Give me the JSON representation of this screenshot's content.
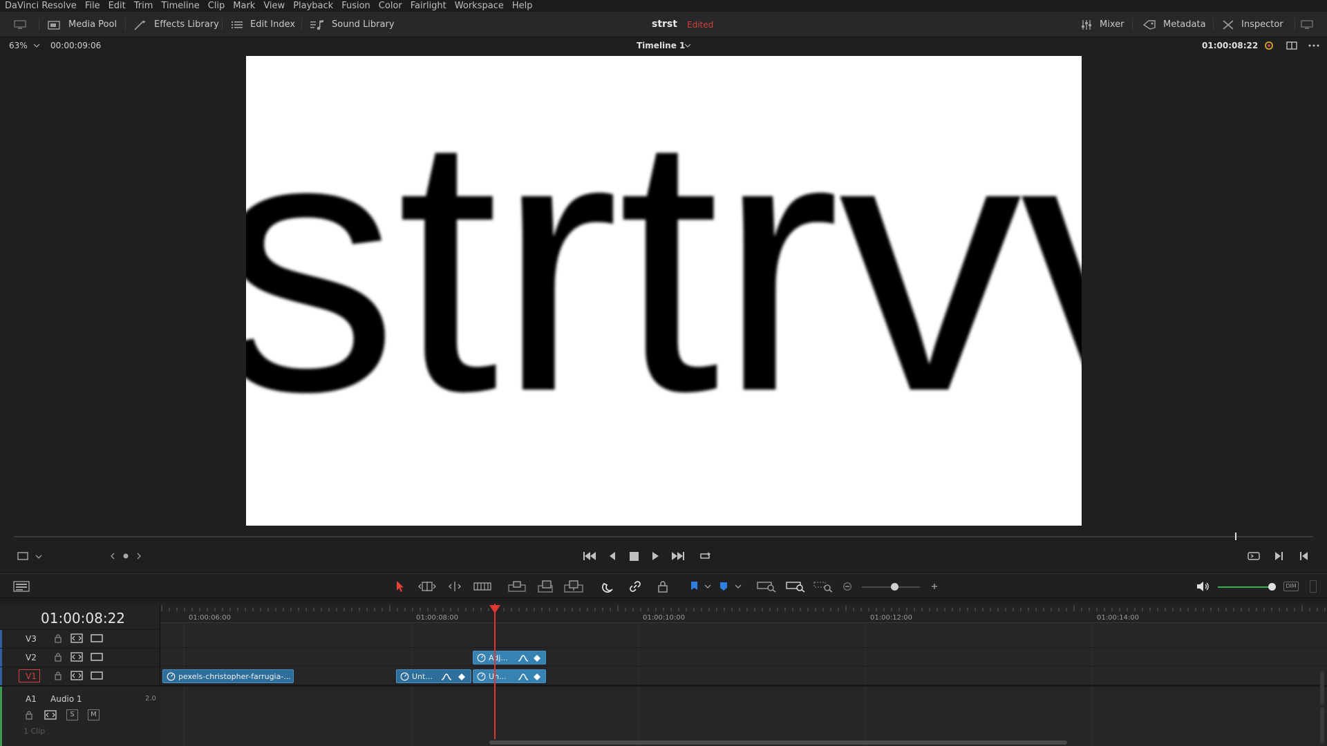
{
  "menu": [
    "DaVinci Resolve",
    "File",
    "Edit",
    "Trim",
    "Timeline",
    "Clip",
    "Mark",
    "View",
    "Playback",
    "Fusion",
    "Color",
    "Fairlight",
    "Workspace",
    "Help"
  ],
  "toolbar": {
    "media_pool": "Media Pool",
    "effects_library": "Effects Library",
    "edit_index": "Edit Index",
    "sound_library": "Sound Library",
    "project_name": "strst",
    "project_status": "Edited",
    "mixer": "Mixer",
    "metadata": "Metadata",
    "inspector": "Inspector"
  },
  "viewer": {
    "zoom": "63%",
    "source_timecode": "00:00:09:06",
    "timeline_name": "Timeline 1",
    "record_timecode": "01:00:08:22",
    "frame_text": "strtrvv",
    "playhead_position": 0.94
  },
  "timeline": {
    "current_timecode": "01:00:08:22",
    "ruler_labels": [
      "01:00:06:00",
      "01:00:08:00",
      "01:00:10:00",
      "01:00:12:00",
      "01:00:14:00"
    ],
    "tracks": {
      "v3": "V3",
      "v2": "V2",
      "v1": "V1",
      "a1": "A1",
      "a1_name": "Audio 1",
      "a1_channels": "2.0",
      "a1_clip_count": "1 Clip",
      "solo": "S",
      "mute": "M"
    },
    "clips": {
      "v1_pexels": "pexels-christopher-farrugia-...",
      "v1_unt1": "Unt...",
      "v1_unt2": "Un...",
      "v2_adj": "Adj..."
    },
    "volume_level": 1.0,
    "dim_label": "DIM"
  },
  "colors": {
    "accent_red": "#e0372f",
    "clip_blue": "#2e6e9a",
    "volume_green": "#3ab04a",
    "flag_blue": "#2f7fe0"
  }
}
